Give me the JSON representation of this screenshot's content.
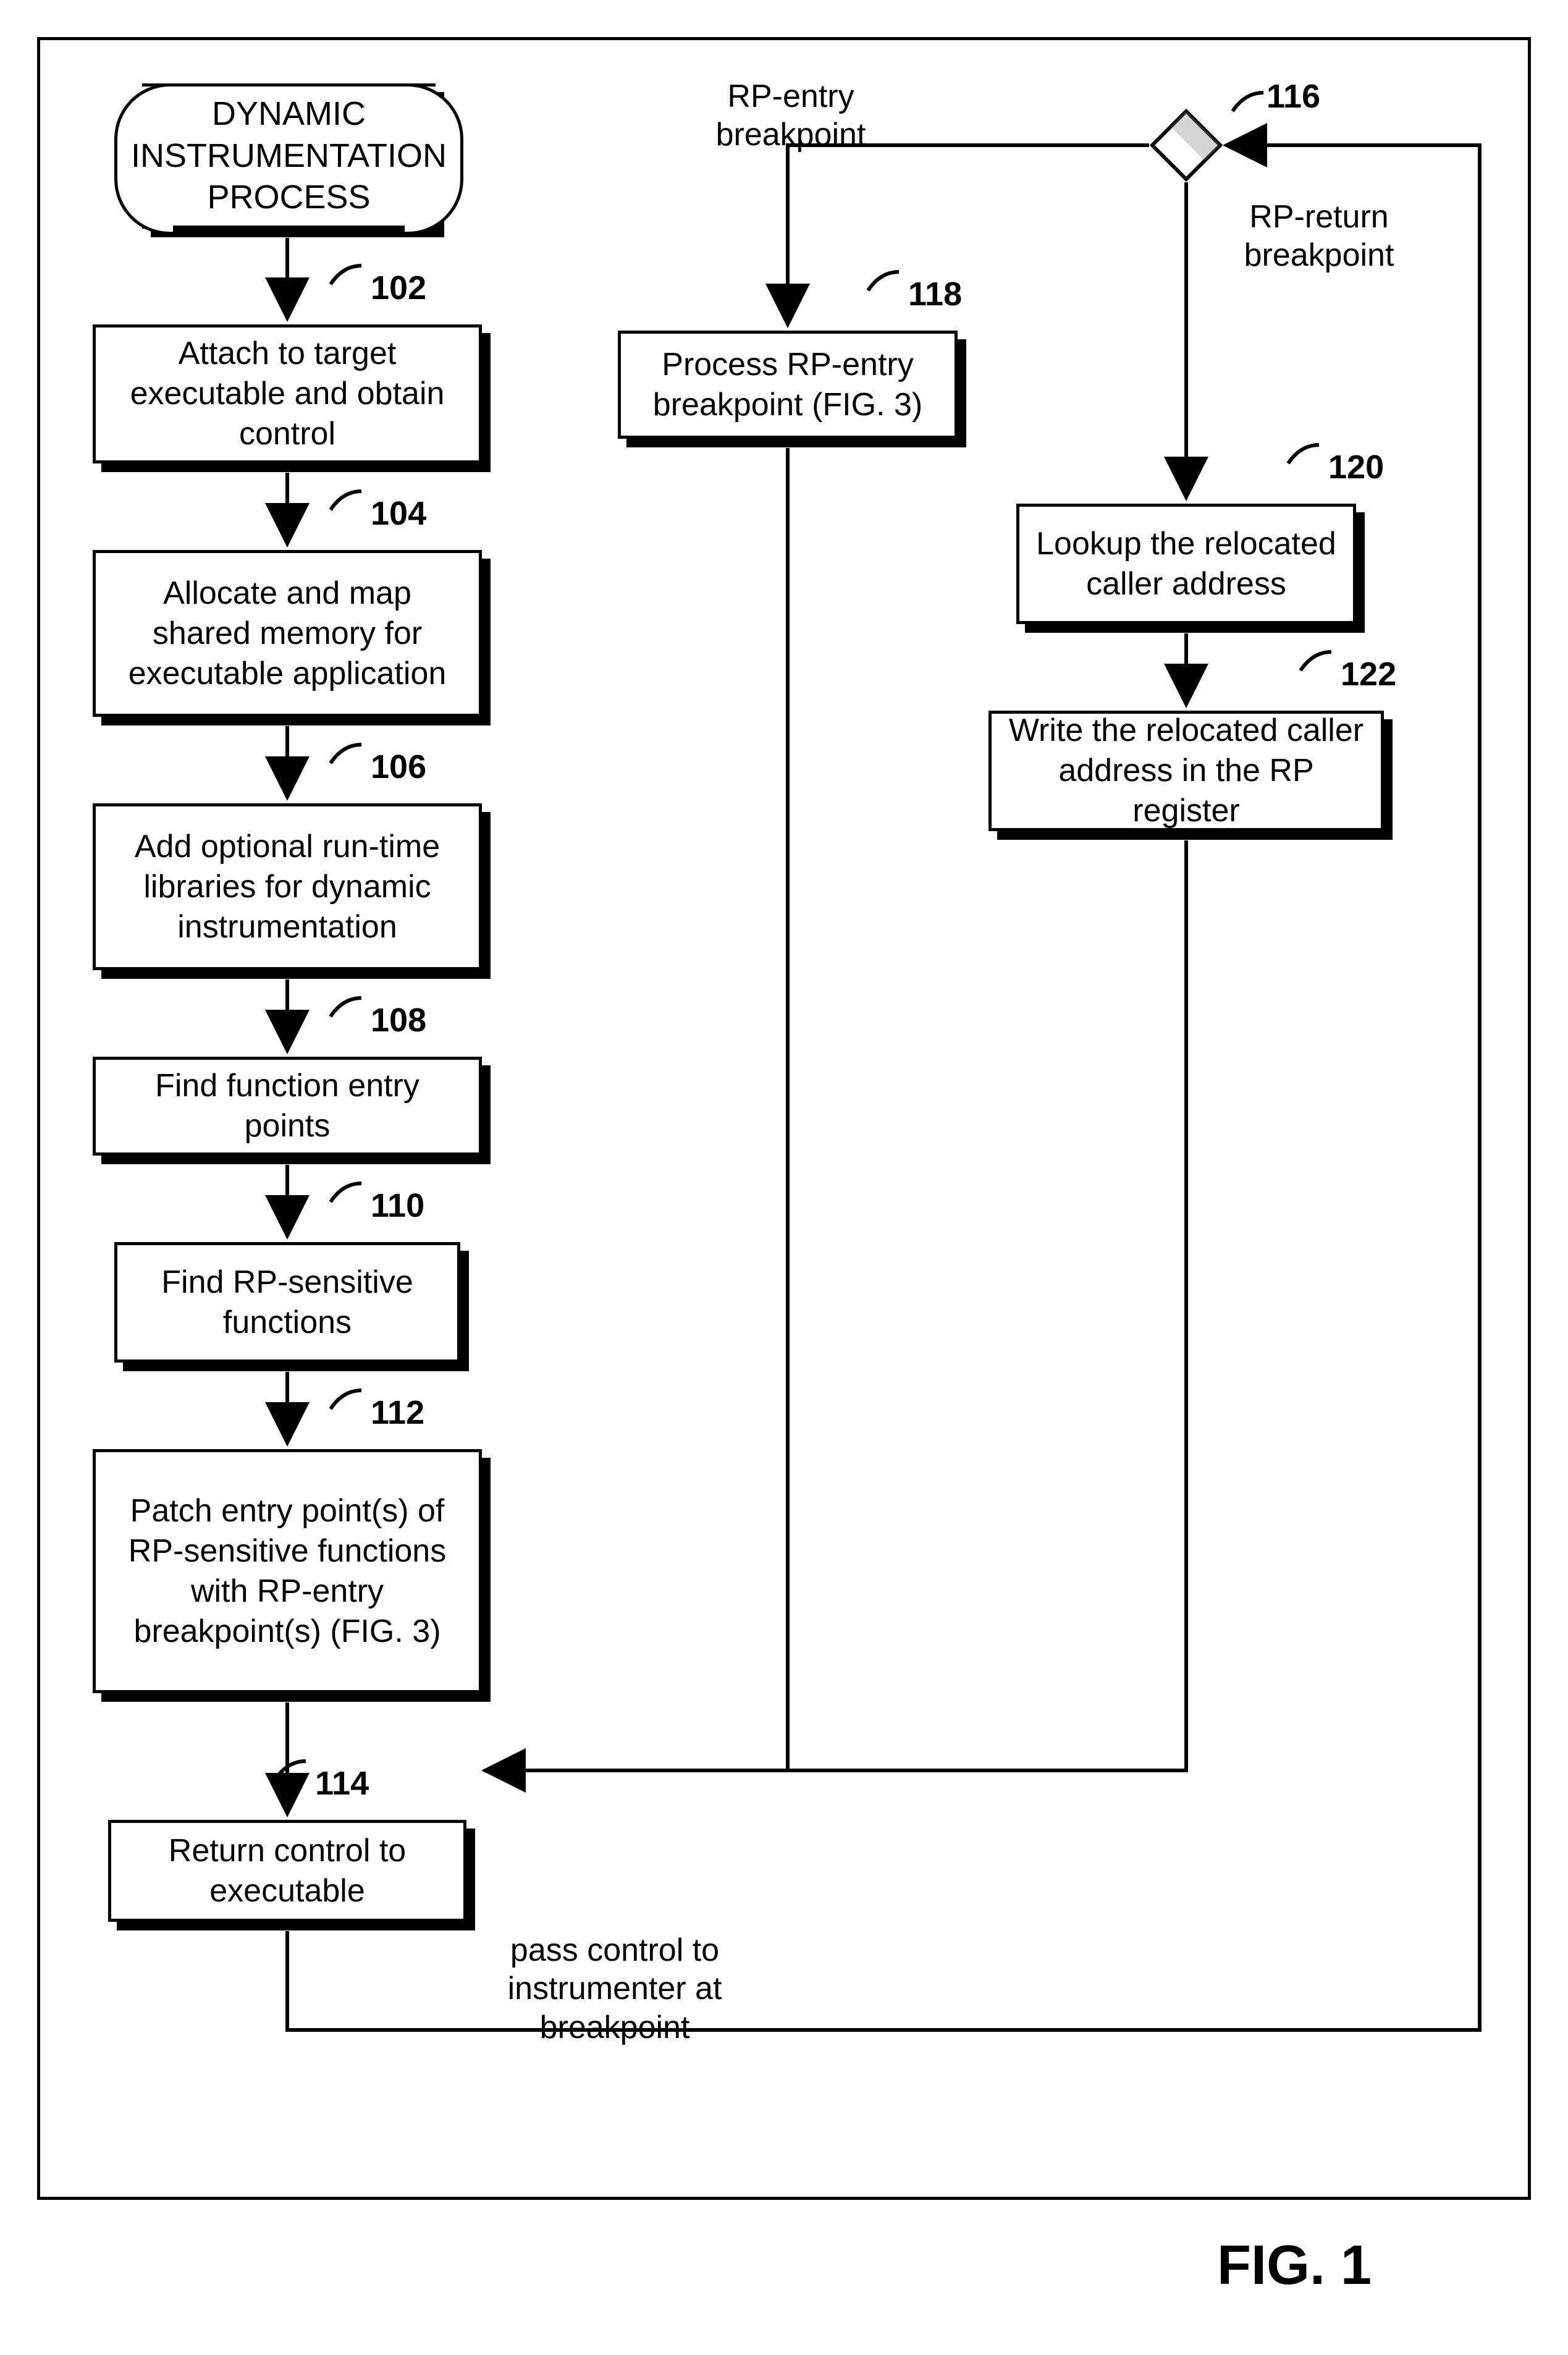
{
  "title": "DYNAMIC INSTRUMENTATION PROCESS",
  "steps": {
    "s102": "Attach to target executable and obtain control",
    "s104": "Allocate and map shared memory for executable application",
    "s106": "Add optional run-time libraries for dynamic instrumentation",
    "s108": "Find function entry points",
    "s110": "Find RP-sensitive functions",
    "s112": "Patch entry point(s) of RP-sensitive functions with RP-entry breakpoint(s) (FIG. 3)",
    "s114": "Return control to executable",
    "s118": "Process RP-entry breakpoint (FIG. 3)",
    "s120": "Lookup the relocated caller address",
    "s122": "Write the relocated caller address in the RP register"
  },
  "nums": {
    "n102": "102",
    "n104": "104",
    "n106": "106",
    "n108": "108",
    "n110": "110",
    "n112": "112",
    "n114": "114",
    "n116": "116",
    "n118": "118",
    "n120": "120",
    "n122": "122"
  },
  "labels": {
    "rpEntry": "RP-entry breakpoint",
    "rpReturn": "RP-return breakpoint",
    "passControl": "pass control to instrumenter at breakpoint"
  },
  "figure": "FIG. 1"
}
